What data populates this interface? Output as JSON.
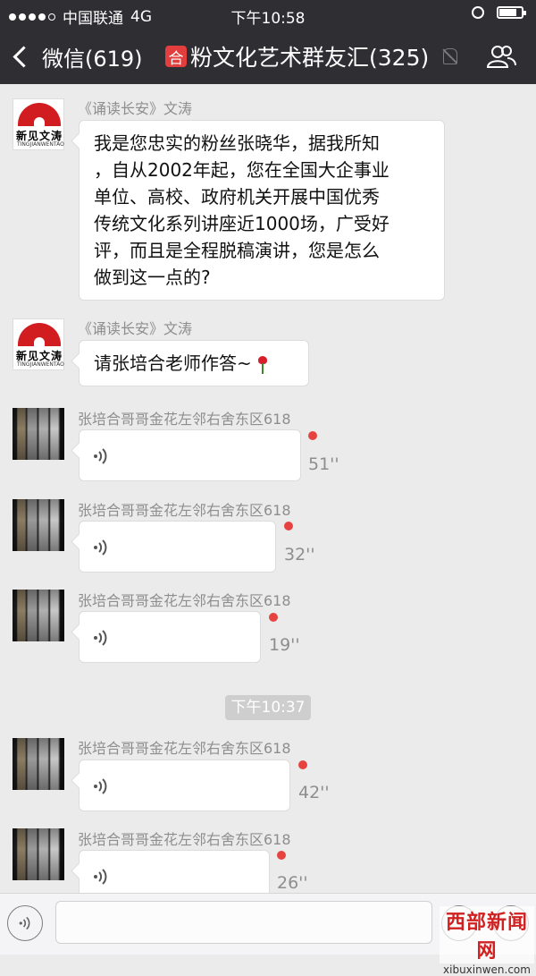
{
  "status_bar": {
    "carrier": "中国联通",
    "network": "4G",
    "time": "下午10:58",
    "signal_bars": 4,
    "battery_level": 0.8
  },
  "nav": {
    "back_label": "微信(619)",
    "group_icon_char": "合",
    "title": "粉文化艺术群友汇(325)"
  },
  "messages": [
    {
      "sender": "《诵读长安》文涛",
      "avatar_text": "新见文涛",
      "avatar_sub": "TINGJIANWENTAO",
      "lines": [
        "我是您忠实的粉丝张晓华，据我所知",
        "，自从2002年起，您在全国大企事业",
        "单位、高校、政府机关开展中国优秀",
        "传统文化系列讲座近1000场，广受好",
        "评，而且是全程脱稿演讲，您是怎么",
        "做到这一点的?"
      ]
    },
    {
      "sender": "《诵读长安》文涛",
      "avatar_text": "新见文涛",
      "avatar_sub": "TINGJIANWENTAO",
      "text": "请张培合老师作答~"
    },
    {
      "sender": "张培合哥哥金花左邻右舍东区618",
      "duration": "51''"
    },
    {
      "sender": "张培合哥哥金花左邻右舍东区618",
      "duration": "32''"
    },
    {
      "sender": "张培合哥哥金花左邻右舍东区618",
      "duration": "19''"
    },
    {
      "sender": "张培合哥哥金花左邻右舍东区618",
      "duration": "42''"
    },
    {
      "sender": "张培合哥哥金花左邻右舍东区618",
      "duration": "26''"
    }
  ],
  "timestamp": "下午10:37",
  "watermark": {
    "line1": "西部新闻网",
    "line2": "xibuxinwen.com"
  },
  "colors": {
    "nav_bg": "#2e2e33",
    "chat_bg": "#ebebeb",
    "unread_dot": "#e64340",
    "group_icon": "#e23e3e"
  }
}
